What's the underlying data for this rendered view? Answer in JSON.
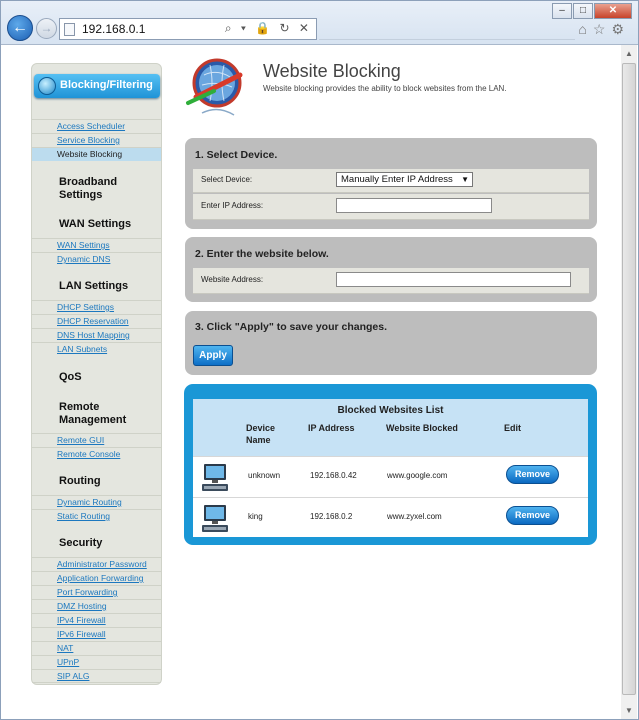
{
  "browser": {
    "url": "192.168.0.1",
    "address_tools": "⌕ ▾ 🔒 ↻ ✕"
  },
  "sidebar": {
    "active_section": "Blocking/Filtering",
    "blocking_links": [
      "Access Scheduler",
      "Service Blocking",
      "Website Blocking"
    ],
    "broadband": "Broadband Settings",
    "wan": "WAN Settings",
    "wan_links": [
      "WAN Settings",
      "Dynamic DNS"
    ],
    "lan": "LAN Settings",
    "lan_links": [
      "DHCP Settings",
      "DHCP Reservation",
      "DNS Host Mapping",
      "LAN Subnets"
    ],
    "qos": "QoS",
    "remote": "Remote Management",
    "remote_links": [
      "Remote GUI",
      "Remote Console"
    ],
    "routing": "Routing",
    "routing_links": [
      "Dynamic Routing",
      "Static Routing"
    ],
    "security": "Security",
    "security_links": [
      "Administrator Password",
      "Application Forwarding",
      "Port Forwarding",
      "DMZ Hosting",
      "IPv4 Firewall",
      "IPv6 Firewall",
      "NAT",
      "UPnP",
      "SIP ALG"
    ]
  },
  "header": {
    "title": "Website Blocking",
    "subtitle": "Website blocking provides the ability to block websites from the LAN."
  },
  "step1": {
    "title": "1. Select Device.",
    "device_label": "Select Device:",
    "device_value": "Manually Enter IP Address",
    "ip_label": "Enter IP Address:",
    "ip_value": ""
  },
  "step2": {
    "title": "2. Enter the website below.",
    "website_label": "Website Address:",
    "website_value": ""
  },
  "step3": {
    "title": "3. Click \"Apply\" to save your changes.",
    "apply_label": "Apply"
  },
  "blocked_list": {
    "title": "Blocked Websites List",
    "columns": [
      "Device Name",
      "IP Address",
      "Website Blocked",
      "Edit"
    ],
    "rows": [
      {
        "device": "unknown",
        "ip": "192.168.0.42",
        "website": "www.google.com",
        "action": "Remove"
      },
      {
        "device": "king",
        "ip": "192.168.0.2",
        "website": "www.zyxel.com",
        "action": "Remove"
      }
    ]
  },
  "colors": {
    "accent_blue": "#1a97d6",
    "panel_gray": "#bdbdbd",
    "link_blue": "#1c78bf"
  }
}
